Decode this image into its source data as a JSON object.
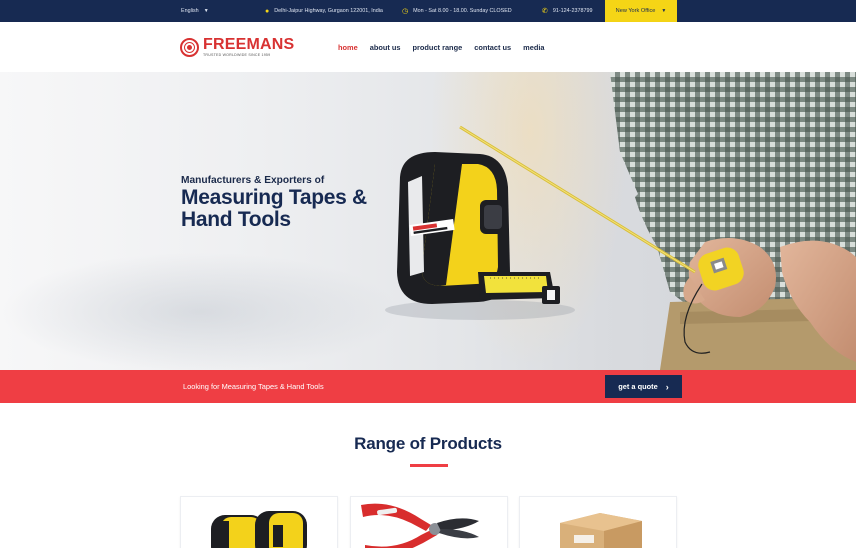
{
  "topbar": {
    "language": "English",
    "address": "Delhi-Jaipur Highway, Gurgaon 122001, India",
    "hours": "Mon - Sat 8.00 - 18.00. Sunday CLOSED",
    "phone": "91-124-2378799",
    "office": "New York Office"
  },
  "header": {
    "logo_name": "FREEMANS",
    "logo_tagline": "TRUSTED WORLDWIDE SINCE 1959",
    "nav": [
      "home",
      "about us",
      "product range",
      "contact us",
      "media"
    ]
  },
  "hero": {
    "subtitle": "Manufacturers & Exporters of",
    "title_line1": "Measuring Tapes &",
    "title_line2": "Hand Tools",
    "tape_brand": "FREEMAN",
    "tape_model": "STRIKER"
  },
  "cta": {
    "text": "Looking for Measuring Tapes & Hand Tools",
    "button": "get a quote"
  },
  "products": {
    "title": "Range of Products"
  },
  "colors": {
    "navy": "#172a52",
    "accent_red": "#ef3e44",
    "yellow": "#f5d516"
  }
}
